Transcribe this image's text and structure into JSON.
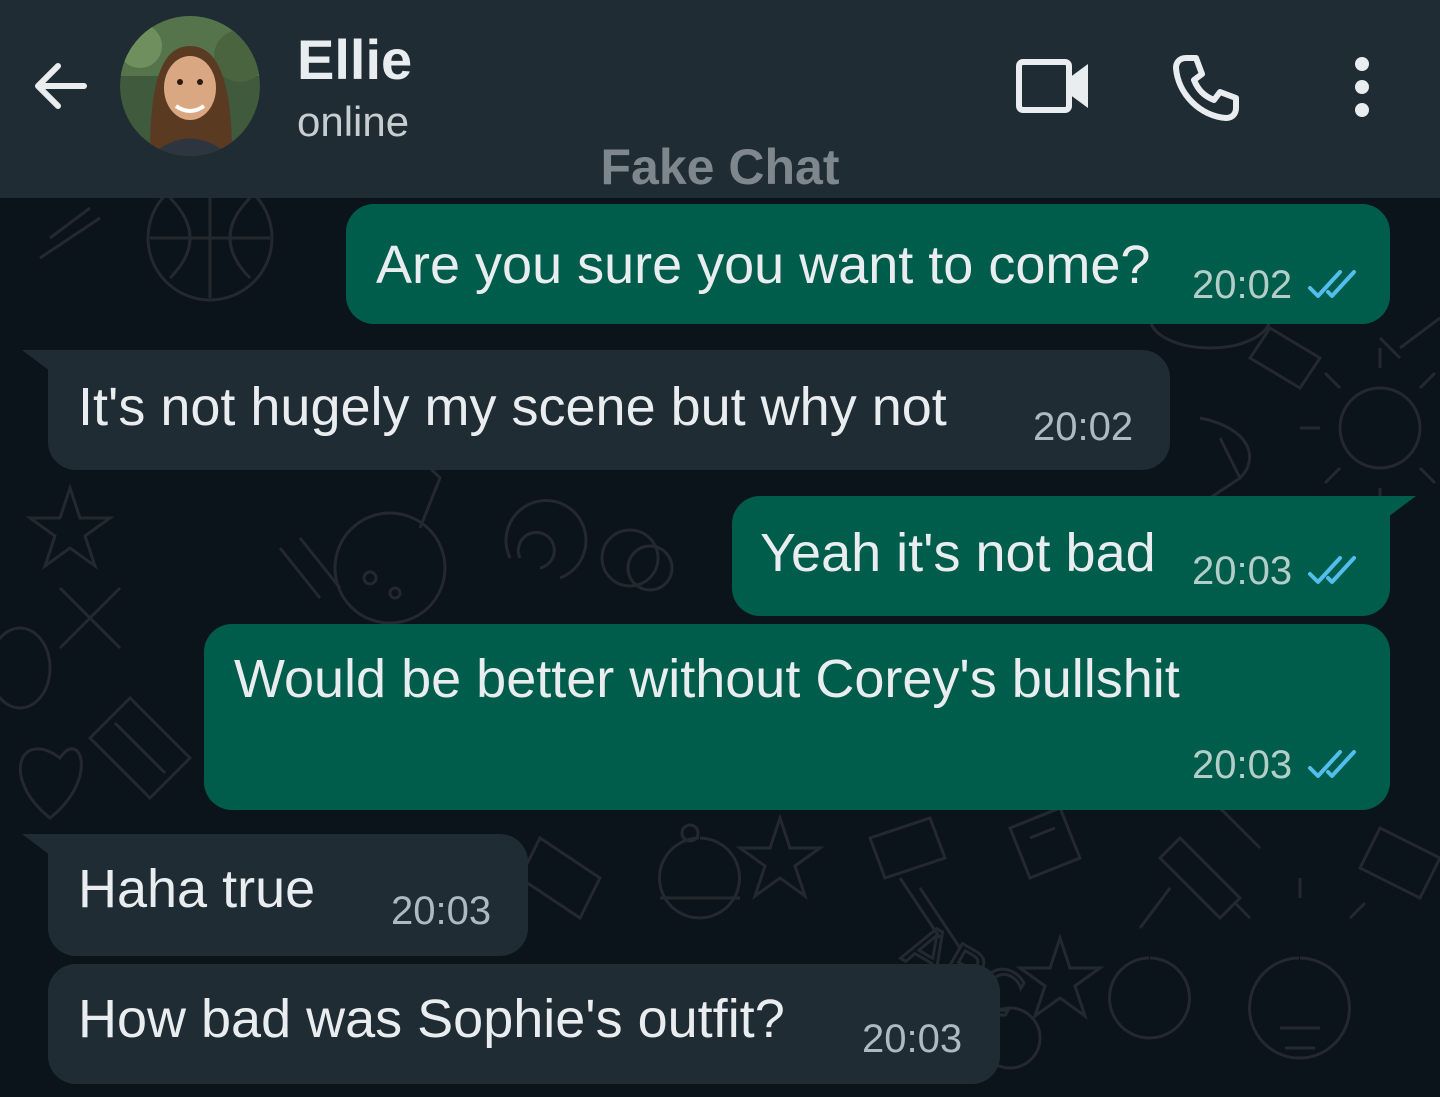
{
  "header": {
    "contact_name": "Ellie",
    "status": "online",
    "watermark": "Fake Chat",
    "background_color": "#1f2c34",
    "icons": [
      "arrow-back-icon",
      "video-call-icon",
      "phone-call-icon",
      "more-options-icon"
    ]
  },
  "chat": {
    "background_color": "#0b141a",
    "outgoing_color": "#005c4b",
    "incoming_color": "#1f2c34",
    "read_tick_color": "#53bdeb",
    "messages": [
      {
        "direction": "out",
        "text": "Are you sure you want to come?",
        "time": "20:02",
        "status": "read"
      },
      {
        "direction": "in",
        "text": "It's not hugely my scene but why not",
        "time": "20:02"
      },
      {
        "direction": "out",
        "text": "Yeah it's not bad",
        "time": "20:03",
        "status": "read"
      },
      {
        "direction": "out",
        "text": "Would be better without Corey's bullshit",
        "time": "20:03",
        "status": "read"
      },
      {
        "direction": "in",
        "text": "Haha true",
        "time": "20:03"
      },
      {
        "direction": "in",
        "text": "How bad was Sophie's outfit?",
        "time": "20:03"
      }
    ]
  }
}
